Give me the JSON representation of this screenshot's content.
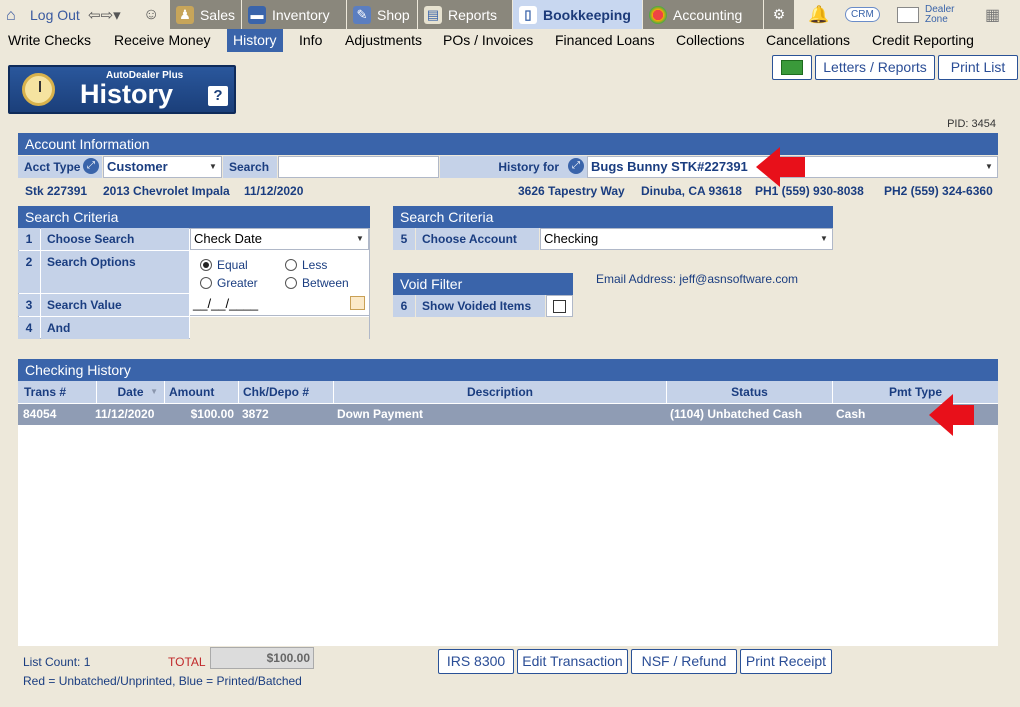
{
  "topnav": {
    "logout": "Log Out",
    "tabs": [
      {
        "label": "Sales",
        "icon": "salesperson-icon"
      },
      {
        "label": "Inventory",
        "icon": "car-icon"
      },
      {
        "label": "Shop",
        "icon": "wrench-icon"
      },
      {
        "label": "Reports",
        "icon": "report-icon"
      },
      {
        "label": "Bookkeeping",
        "icon": "book-icon"
      },
      {
        "label": "Accounting",
        "icon": "pie-chart-icon"
      }
    ],
    "crm": "CRM",
    "dealer_zone": "Dealer Zone"
  },
  "subnav": [
    "Write Checks",
    "Receive Money",
    "History",
    "Info",
    "Adjustments",
    "POs / Invoices",
    "Financed Loans",
    "Collections",
    "Cancellations",
    "Credit Reporting"
  ],
  "logo": {
    "brand": "AutoDealer Plus",
    "title": "History",
    "help": "?"
  },
  "actions": {
    "letters": "Letters / Reports",
    "print_list": "Print List"
  },
  "pid": "PID: 3454",
  "account": {
    "header": "Account Information",
    "acct_type_label": "Acct Type",
    "acct_type_value": "Customer",
    "search_label": "Search",
    "search_value": "",
    "history_for_label": "History for",
    "history_for_value": "Bugs Bunny  STK#227391",
    "stk": "Stk 227391",
    "vehicle": "2013 Chevrolet Impala",
    "date": "11/12/2020",
    "address": "3626 Tapestry Way",
    "city": "Dinuba, CA 93618",
    "ph1": "PH1 (559) 930-8038",
    "ph2": "PH2 (559) 324-6360"
  },
  "criteria_left": {
    "header": "Search Criteria",
    "rows": [
      {
        "num": "1",
        "label": "Choose Search",
        "value": "Check Date"
      },
      {
        "num": "2",
        "label": "Search Options"
      },
      {
        "num": "3",
        "label": "Search Value",
        "value": "__/__/____"
      },
      {
        "num": "4",
        "label": "And"
      }
    ],
    "options": {
      "equal": "Equal",
      "less": "Less",
      "greater": "Greater",
      "between": "Between"
    }
  },
  "criteria_right": {
    "header": "Search Criteria",
    "num": "5",
    "label": "Choose Account",
    "value": "Checking"
  },
  "void_filter": {
    "header": "Void Filter",
    "num": "6",
    "label": "Show Voided Items"
  },
  "email": "Email Address: jeff@asnsoftware.com",
  "history": {
    "header": "Checking History",
    "columns": [
      "Trans #",
      "Date",
      "Amount",
      "Chk/Depo #",
      "Description",
      "Status",
      "Pmt Type"
    ],
    "rows": [
      {
        "trans": "84054",
        "date": "11/12/2020",
        "amount": "$100.00",
        "chk": "3872",
        "description": "Down Payment",
        "status": "(1104) Unbatched Cash",
        "pmt": "Cash"
      }
    ]
  },
  "footer": {
    "list_count": "List Count: 1",
    "total_label": "TOTAL",
    "total_value": "$100.00",
    "legend": "Red = Unbatched/Unprinted, Blue = Printed/Batched",
    "buttons": [
      "IRS 8300",
      "Edit Transaction",
      "NSF / Refund",
      "Print Receipt"
    ]
  }
}
